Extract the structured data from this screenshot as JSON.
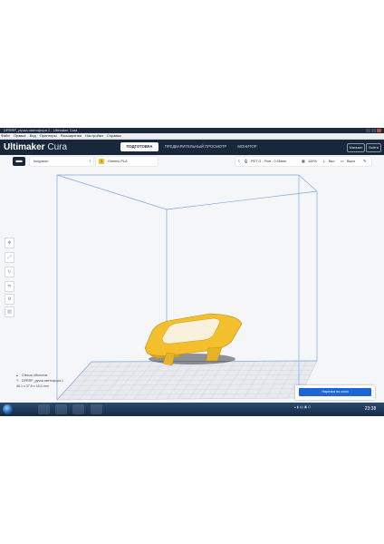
{
  "window": {
    "title": "DPRRP_ручка светофора 1 - Ultimaker Cura"
  },
  "menu": {
    "items": [
      "Файл",
      "Правка",
      "Вид",
      "Принтеры",
      "Расширения",
      "Настройки",
      "Справка"
    ]
  },
  "header": {
    "brand_bold": "Ultimaker",
    "brand_light": " Cura",
    "stages": {
      "prepare": "ПОДГОТОВКА",
      "preview": "ПРЕДВАРИТЕЛЬНЫЙ ПРОСМОТР",
      "monitor": "МОНИТОР"
    },
    "marketplace": "Магазин",
    "signin": "Войти"
  },
  "toolbar": {
    "folder_icon": "folder-icon",
    "printer_name": "longneon",
    "material_badge": "1",
    "material_name": "Generic PLA",
    "profile": "PET G - Fine - 0.05mm",
    "infill": "100%",
    "support": "Вкл",
    "adhesion": "Выкл"
  },
  "tools": [
    "move-icon",
    "scale-icon",
    "rotate-icon",
    "mirror-icon",
    "per-model-settings-icon",
    "support-blocker-icon"
  ],
  "objects": {
    "list_label": "Список объектов",
    "object_name": "DPRRP_ручка светофора 1",
    "dimensions": "46.1 x 37.8 x 18.0 mm"
  },
  "slice": {
    "button_label": "Нарезка на слои"
  },
  "taskbar": {
    "clock": "23:38"
  },
  "colors": {
    "header": "#19273a",
    "accent": "#1e66d6",
    "model": "#f6c02d"
  }
}
